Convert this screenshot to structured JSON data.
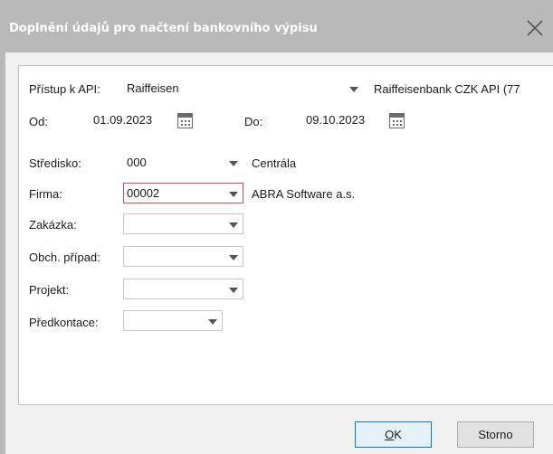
{
  "dialog": {
    "title": "Doplnění údajů pro načtení bankovního výpisu"
  },
  "form": {
    "api": {
      "label": "Přístup k API:",
      "value": "Raiffeisen",
      "description": "Raiffeisenbank CZK API (77"
    },
    "from": {
      "label": "Od:",
      "value": "01.09.2023"
    },
    "to": {
      "label": "Do:",
      "value": "09.10.2023"
    },
    "stredisko": {
      "label": "Středisko:",
      "value": "000",
      "description": "Centrála"
    },
    "firma": {
      "label": "Firma:",
      "value": "00002",
      "description": "ABRA Software a.s."
    },
    "zakazka": {
      "label": "Zakázka:",
      "value": ""
    },
    "obch_pripad": {
      "label": "Obch. případ:",
      "value": ""
    },
    "projekt": {
      "label": "Projekt:",
      "value": ""
    },
    "predkontace": {
      "label": "Předkontace:",
      "value": ""
    }
  },
  "buttons": {
    "ok_hotkey": "O",
    "ok_rest": "K",
    "storno": "Storno"
  },
  "colors": {
    "titlebar": "#b9b9b9",
    "active_field_border": "#d9465a",
    "default_button_border": "#0078d7"
  }
}
